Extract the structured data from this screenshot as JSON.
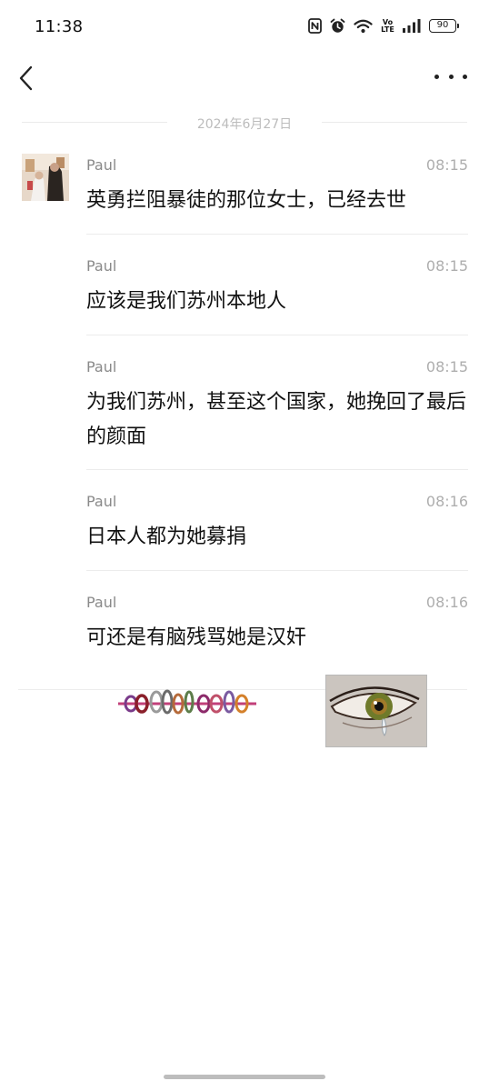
{
  "status_bar": {
    "time": "11:38",
    "volte_line1": "Vo",
    "volte_line2": "LTE",
    "battery": "90"
  },
  "chat": {
    "date": "2024年6月27日",
    "messages": [
      {
        "sender": "Paul",
        "time": "08:15",
        "text": "英勇拦阻暴徒的那位女士，已经去世"
      },
      {
        "sender": "Paul",
        "time": "08:15",
        "text": "应该是我们苏州本地人"
      },
      {
        "sender": "Paul",
        "time": "08:15",
        "text": "为我们苏州，甚至这个国家，她挽回了最后的颜面"
      },
      {
        "sender": "Paul",
        "time": "08:16",
        "text": "日本人都为她募捐"
      },
      {
        "sender": "Paul",
        "time": "08:16",
        "text": "可还是有脑残骂她是汉奸"
      }
    ]
  },
  "icons": {
    "back": "chevron-left-icon",
    "more": "more-horizontal-icon",
    "nfc": "nfc-icon",
    "alarm": "alarm-icon",
    "wifi": "wifi-icon",
    "signal": "signal-icon",
    "battery": "battery-icon"
  }
}
